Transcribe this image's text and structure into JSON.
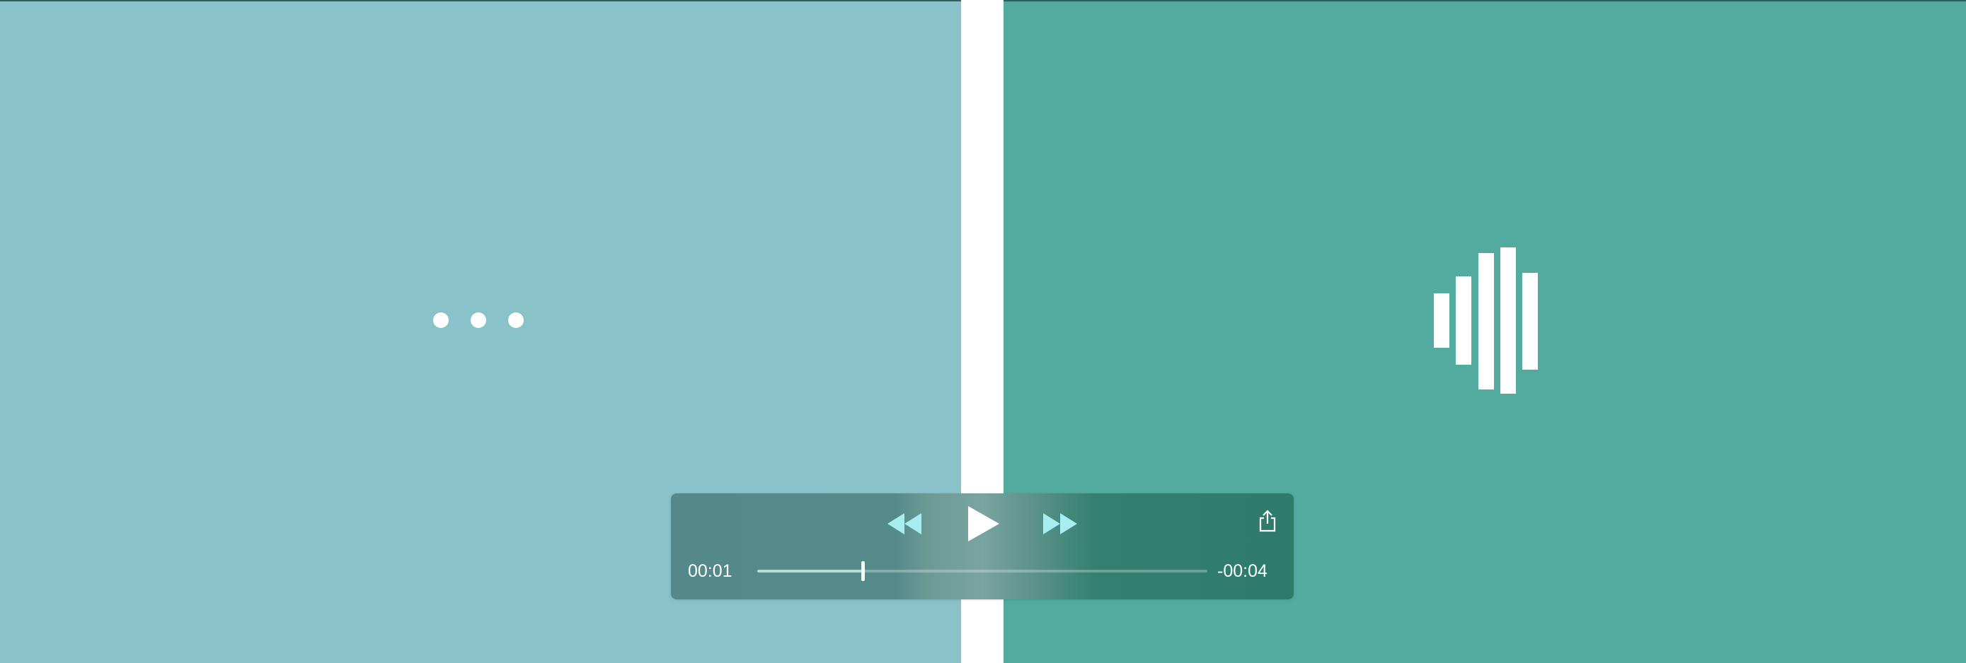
{
  "placeholder_left": {
    "icon": "ellipsis-loading-icon",
    "color": "#8ac2ca"
  },
  "placeholder_right": {
    "icon": "audio-waveform-icon",
    "color": "#53ab9f"
  },
  "player": {
    "current_time": "00:01",
    "remaining_time": "-00:04",
    "progress": 0.235,
    "controls": {
      "rewind_icon": "rewind-icon",
      "play_icon": "play-icon",
      "fast_forward_icon": "fast-forward-icon",
      "share_icon": "share-icon"
    }
  },
  "colors": {
    "accent_icon": "#a8eef0",
    "text": "#ffffff"
  }
}
